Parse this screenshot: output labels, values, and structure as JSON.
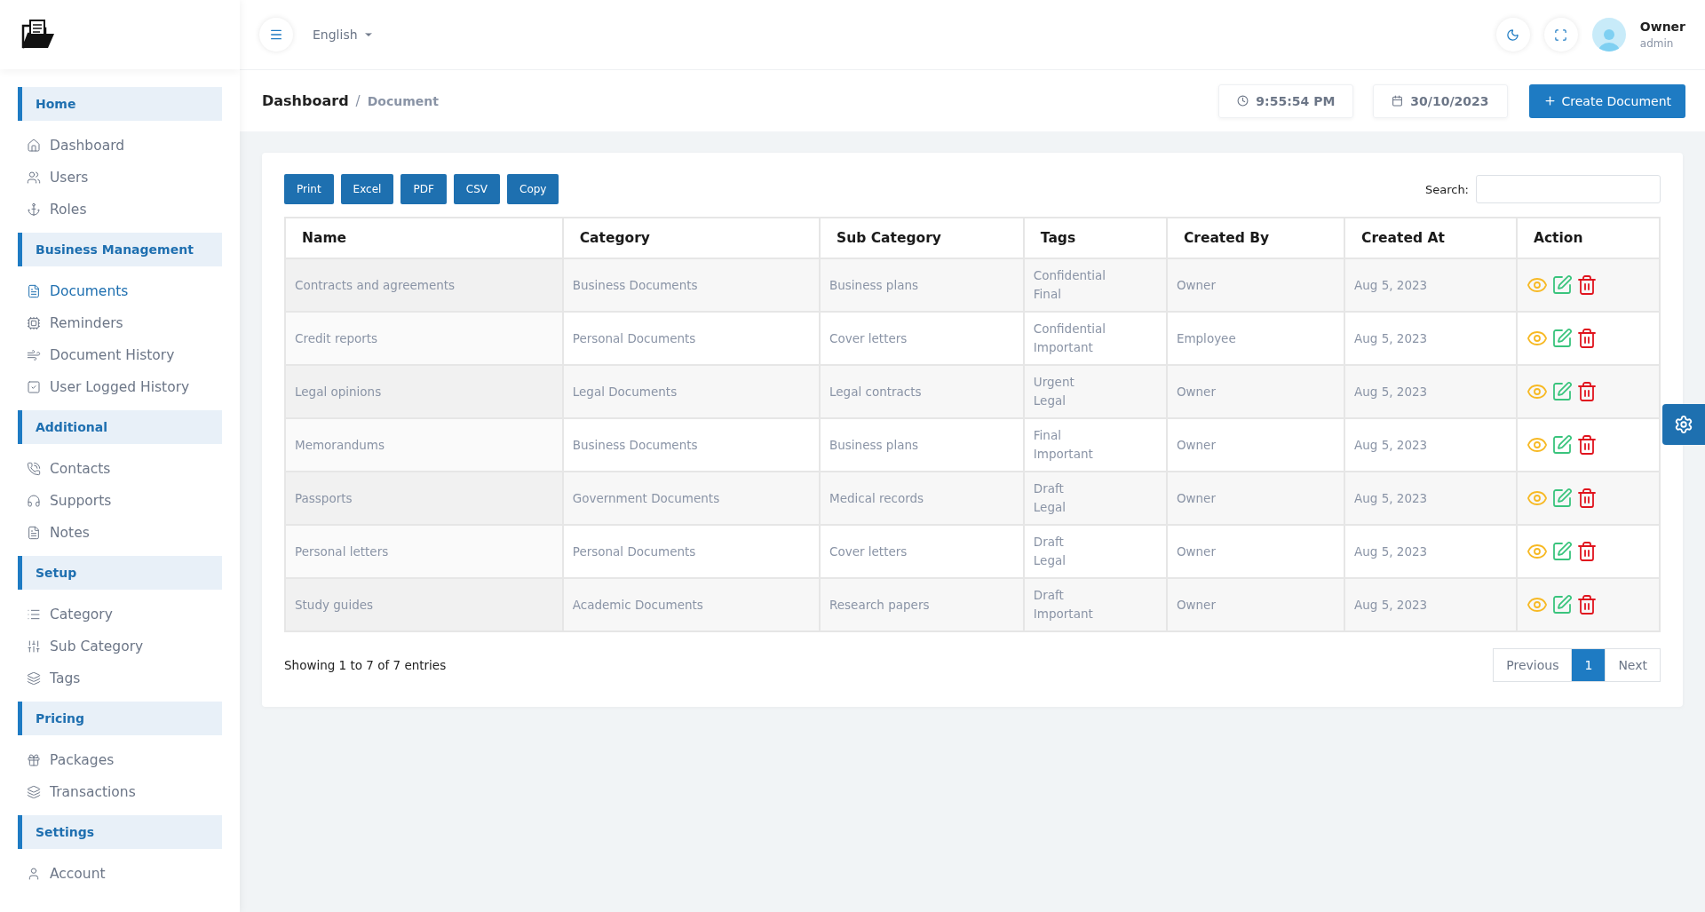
{
  "topbar": {
    "language": "English",
    "user": {
      "name": "Owner",
      "role": "admin"
    }
  },
  "breadcrumb": {
    "items": [
      "Dashboard",
      "Document"
    ],
    "separator": "/"
  },
  "toolbar": {
    "time": "9:55:54 PM",
    "date": "30/10/2023",
    "create_button": "Create Document"
  },
  "sidebar": {
    "sections": [
      {
        "title": "Home",
        "items": [
          {
            "label": "Dashboard",
            "selected": false
          },
          {
            "label": "Users",
            "selected": false
          },
          {
            "label": "Roles",
            "selected": false
          }
        ]
      },
      {
        "title": "Business Management",
        "items": [
          {
            "label": "Documents",
            "selected": true
          },
          {
            "label": "Reminders",
            "selected": false
          },
          {
            "label": "Document History",
            "selected": false
          },
          {
            "label": "User Logged History",
            "selected": false
          }
        ]
      },
      {
        "title": "Additional",
        "items": [
          {
            "label": "Contacts",
            "selected": false
          },
          {
            "label": "Supports",
            "selected": false
          },
          {
            "label": "Notes",
            "selected": false
          }
        ]
      },
      {
        "title": "Setup",
        "items": [
          {
            "label": "Category",
            "selected": false
          },
          {
            "label": "Sub Category",
            "selected": false
          },
          {
            "label": "Tags",
            "selected": false
          }
        ]
      },
      {
        "title": "Pricing",
        "items": [
          {
            "label": "Packages",
            "selected": false
          },
          {
            "label": "Transactions",
            "selected": false
          }
        ]
      },
      {
        "title": "Settings",
        "items": [
          {
            "label": "Account",
            "selected": false
          }
        ]
      }
    ]
  },
  "table": {
    "export_buttons": [
      "Print",
      "Excel",
      "PDF",
      "CSV",
      "Copy"
    ],
    "search_label": "Search:",
    "columns": [
      "Name",
      "Category",
      "Sub Category",
      "Tags",
      "Created By",
      "Created At",
      "Action"
    ],
    "rows": [
      {
        "name": "Contracts and agreements",
        "category": "Business Documents",
        "sub_category": "Business plans",
        "tags": [
          "Confidential",
          "Final"
        ],
        "created_by": "Owner",
        "created_at": "Aug 5, 2023"
      },
      {
        "name": "Credit reports",
        "category": "Personal Documents",
        "sub_category": "Cover letters",
        "tags": [
          "Confidential",
          "Important"
        ],
        "created_by": "Employee",
        "created_at": "Aug 5, 2023"
      },
      {
        "name": "Legal opinions",
        "category": "Legal Documents",
        "sub_category": "Legal contracts",
        "tags": [
          "Urgent",
          "Legal"
        ],
        "created_by": "Owner",
        "created_at": "Aug 5, 2023"
      },
      {
        "name": "Memorandums",
        "category": "Business Documents",
        "sub_category": "Business plans",
        "tags": [
          "Final",
          "Important"
        ],
        "created_by": "Owner",
        "created_at": "Aug 5, 2023"
      },
      {
        "name": "Passports",
        "category": "Government Documents",
        "sub_category": "Medical records",
        "tags": [
          "Draft",
          "Legal"
        ],
        "created_by": "Owner",
        "created_at": "Aug 5, 2023"
      },
      {
        "name": "Personal letters",
        "category": "Personal Documents",
        "sub_category": "Cover letters",
        "tags": [
          "Draft",
          "Legal"
        ],
        "created_by": "Owner",
        "created_at": "Aug 5, 2023"
      },
      {
        "name": "Study guides",
        "category": "Academic Documents",
        "sub_category": "Research papers",
        "tags": [
          "Draft",
          "Important"
        ],
        "created_by": "Owner",
        "created_at": "Aug 5, 2023"
      }
    ],
    "info": "Showing 1 to 7 of 7 entries",
    "pagination": [
      {
        "label": "Previous",
        "selected": false
      },
      {
        "label": "1",
        "selected": true
      },
      {
        "label": "Next",
        "selected": false
      }
    ]
  }
}
